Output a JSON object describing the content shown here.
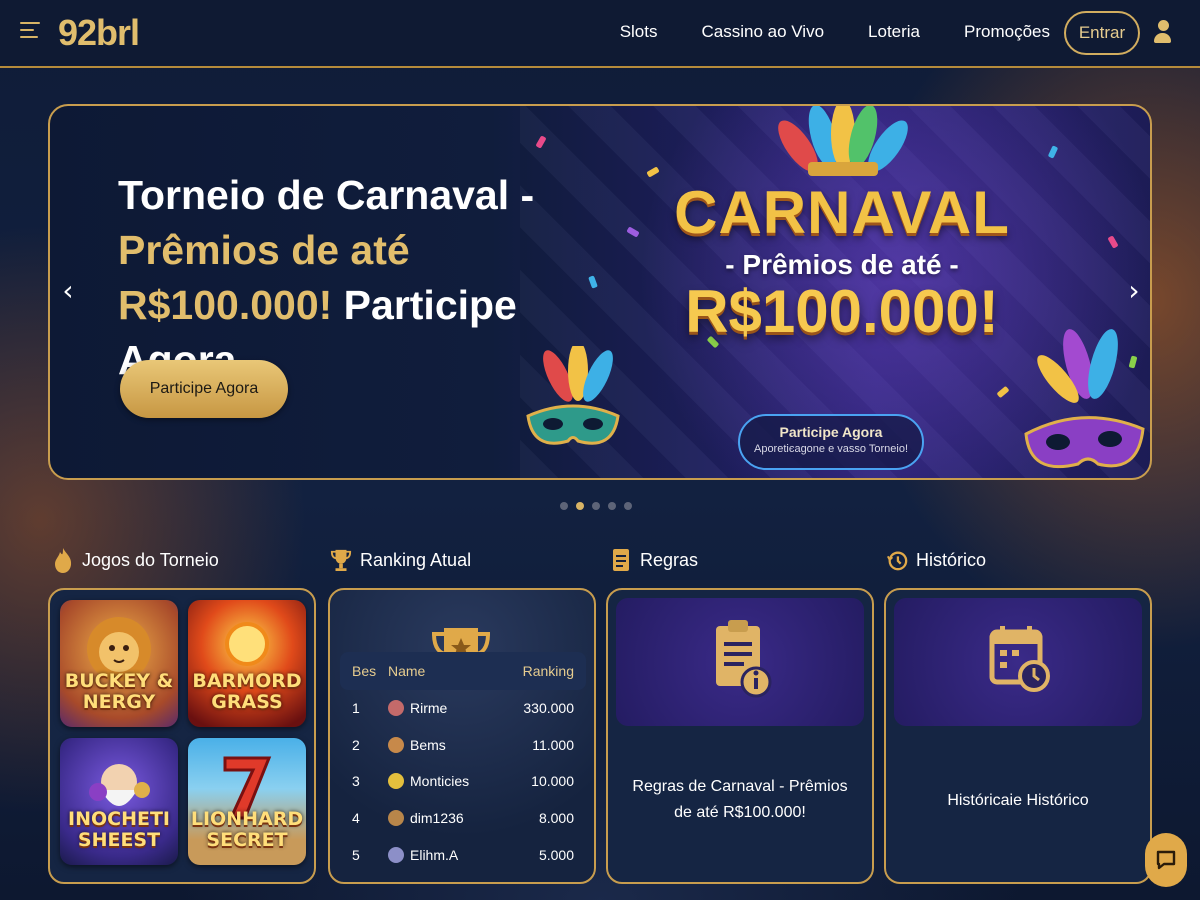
{
  "header": {
    "logo": "92brl",
    "nav": [
      "Slots",
      "Cassino ao Vivo",
      "Loteria",
      "Promoções"
    ],
    "login_label": "Entrar"
  },
  "banner": {
    "title_line1": "Torneio de Carnaval -",
    "title_line2": "Prêmios de até",
    "title_amount": "R$100.000!",
    "title_tail": " Participe Agora",
    "cta_label": "Participe Agora",
    "art": {
      "word": "CARNAVAL",
      "sub": "- Prêmios de até -",
      "amount": "R$100.000!",
      "cta_line1": "Participe Agora",
      "cta_line2": "Aporetiє​agone e vasso Torneio!"
    },
    "slides_total": 5,
    "active_slide": 2
  },
  "sections": {
    "games_title": "Jogos do Torneio",
    "ranking_title": "Ranking Atual",
    "rules_title": "Regras",
    "history_title": "Histórico"
  },
  "games": [
    {
      "name": "BUCKEY & NERGY"
    },
    {
      "name": "BARMORD GRASS"
    },
    {
      "name": "INOCHETI SHEEST"
    },
    {
      "name": "LIONHARD SECRET"
    }
  ],
  "ranking": {
    "headers": {
      "pos": "Bes",
      "name": "Name",
      "value": "Ranking"
    },
    "rows": [
      {
        "pos": "1",
        "name": "Rirme",
        "value": "330.000",
        "avatar_color": "#c46a6a"
      },
      {
        "pos": "2",
        "name": "Bems",
        "value": "11.000",
        "avatar_color": "#c7894a"
      },
      {
        "pos": "3",
        "name": "Monticies",
        "value": "10.000",
        "avatar_color": "#e3bf3d"
      },
      {
        "pos": "4",
        "name": "dim1236",
        "value": "8.000",
        "avatar_color": "#b8864a"
      },
      {
        "pos": "5",
        "name": "Elihm.A",
        "value": "5.000",
        "avatar_color": "#8c8fc8"
      }
    ]
  },
  "rules": {
    "text": "Regras de Carnaval - Prêmios de até R$100.000!"
  },
  "history": {
    "text": "Históricaie Histórico"
  },
  "colors": {
    "accent_gold": "#d8b465",
    "background": "#0e1a33",
    "highlight_blue": "#4aa3f2"
  }
}
